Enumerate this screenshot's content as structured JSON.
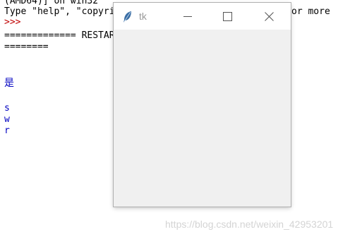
{
  "shell": {
    "lines": [
      {
        "text": "(AMD64)] on win32",
        "color": "black"
      },
      {
        "text": "Type \"help\", \"copyright\", \"credits\" or \"license()\" for more",
        "color": "black"
      },
      {
        "text": ">>>",
        "color": "red"
      },
      {
        "text": "============= RESTART: C:\\Users\\Desktop\\数字简谱转",
        "color": "black"
      },
      {
        "text": "========",
        "color": "black"
      },
      {
        "text": "是",
        "color": "blue"
      },
      {
        "text": "s",
        "color": "blue"
      },
      {
        "text": "w",
        "color": "blue"
      },
      {
        "text": "r",
        "color": "blue"
      }
    ]
  },
  "tk_window": {
    "title": "tk",
    "icon": "feather-icon",
    "controls": [
      "minimize-icon",
      "maximize-icon",
      "close-icon"
    ]
  },
  "watermark": "https://blog.csdn.net/weixin_42953201",
  "colors": {
    "shell_black": "#000000",
    "prompt_red": "#c00000",
    "output_blue": "#0000c0",
    "window_bg": "#f0f0f0",
    "titlebar_bg": "#ffffff",
    "watermark": "#d4d4d4"
  }
}
